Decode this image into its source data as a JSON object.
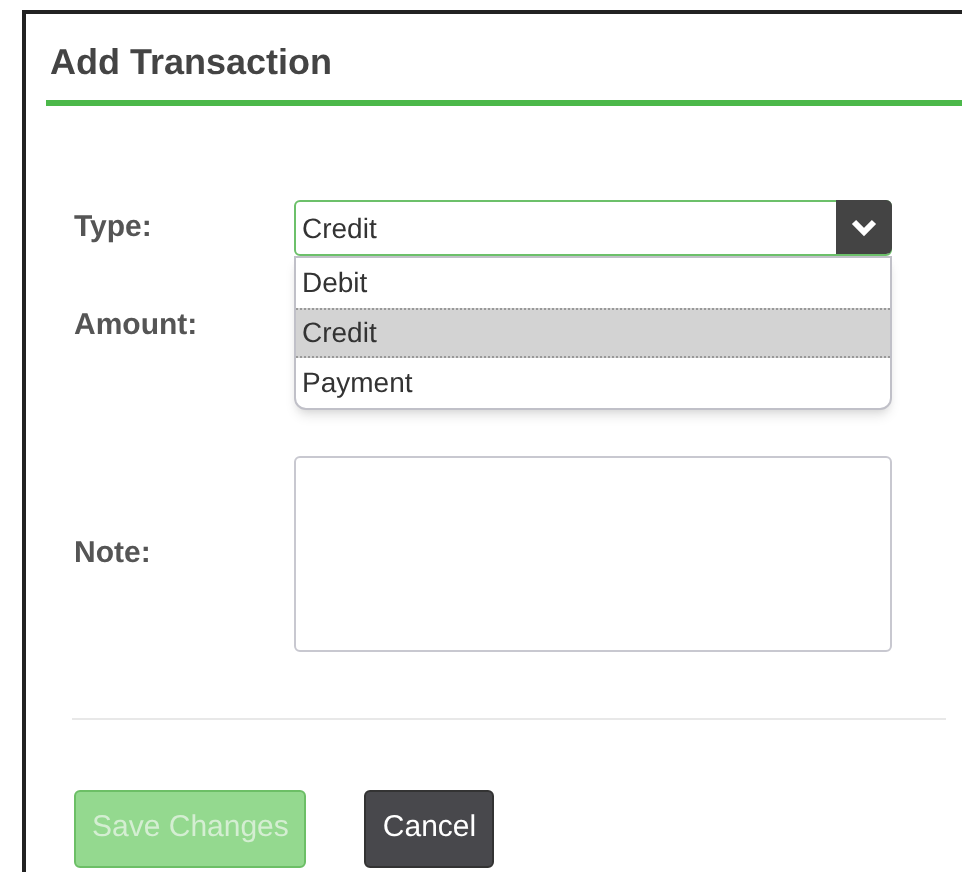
{
  "dialog": {
    "title": "Add Transaction"
  },
  "form": {
    "type_label": "Type:",
    "type_value": "Credit",
    "options": [
      {
        "label": "Debit",
        "selected": false
      },
      {
        "label": "Credit",
        "selected": true
      },
      {
        "label": "Payment",
        "selected": false
      }
    ],
    "amount_label": "Amount:",
    "note_label": "Note:"
  },
  "buttons": [
    {
      "label": "Save Changes",
      "kind": "primary",
      "disabled": true
    },
    {
      "label": "Cancel",
      "kind": "secondary",
      "disabled": false
    }
  ]
}
